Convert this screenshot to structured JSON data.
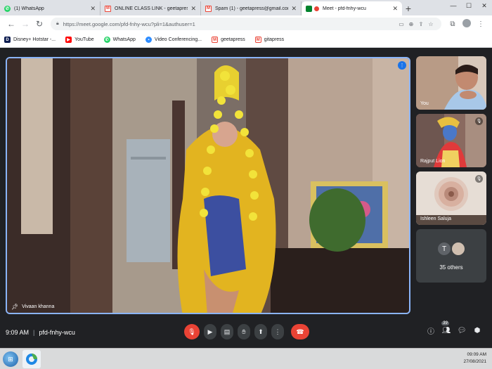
{
  "browser": {
    "tabs": [
      {
        "title": "(1) WhatsApp",
        "favicon": "whatsapp-icon",
        "color": "#25d366",
        "active": false
      },
      {
        "title": "ONLINE CLASS LINK - geetapress",
        "favicon": "gmail-icon",
        "color": "#ea4335",
        "active": false
      },
      {
        "title": "Spam (1) - geetapress@gmail.com",
        "favicon": "gmail-icon",
        "color": "#ea4335",
        "active": false
      },
      {
        "title": "Meet - pfd-fnhy-wcu",
        "favicon": "meet-icon",
        "color": "#00832d",
        "active": true
      }
    ],
    "new_tab": "+",
    "url": "https://meet.google.com/pfd-fnhy-wcu?pli=1&authuser=1",
    "bookmarks": [
      {
        "label": "Disney+ Hotstar -...",
        "icon": "hotstar-icon",
        "color": "#0c1c50"
      },
      {
        "label": "YouTube",
        "icon": "youtube-icon",
        "color": "#ff0000"
      },
      {
        "label": "WhatsApp",
        "icon": "whatsapp-icon",
        "color": "#25d366"
      },
      {
        "label": "Video Conferencing...",
        "icon": "zoom-icon",
        "color": "#2d8cff"
      },
      {
        "label": "geetapress",
        "icon": "gmail-icon",
        "color": "#ea4335"
      },
      {
        "label": "gitapress",
        "icon": "gmail-icon",
        "color": "#ea4335"
      }
    ]
  },
  "meet": {
    "main_participant": "Vivaan khanna",
    "tiles": [
      {
        "name": "You",
        "muted": false
      },
      {
        "name": "Rajput Lion",
        "muted": true
      },
      {
        "name": "Ishleen Saluja",
        "muted": true
      }
    ],
    "others": {
      "initial": "T",
      "label": "35 others",
      "avatar_colors": [
        "#5f6368",
        "#d0bfb0"
      ]
    },
    "time": "9:09 AM",
    "meeting_code": "pfd-fnhy-wcu",
    "participant_count": "39",
    "colors": {
      "accent": "#8ab4f8",
      "danger": "#ea4335",
      "surface": "#3c4043",
      "background": "#202124"
    }
  },
  "taskbar": {
    "time": "09:09 AM",
    "date": "27/08/2021"
  }
}
